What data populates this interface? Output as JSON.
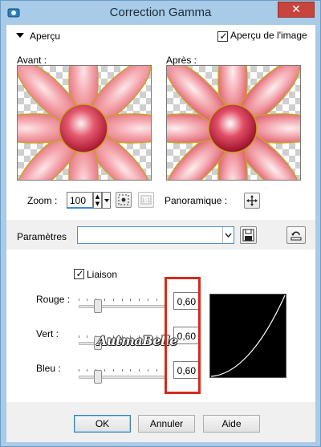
{
  "window": {
    "title": "Correction Gamma",
    "close_glyph": "✕"
  },
  "preview": {
    "section_label": "Aperçu",
    "preview_checkbox_label": "Aperçu de l'image",
    "preview_checked": true,
    "before_label": "Avant :",
    "after_label": "Après :"
  },
  "zoom": {
    "label": "Zoom :",
    "value": "100",
    "pan_label": "Panoramique :"
  },
  "params": {
    "label": "Paramètres",
    "preset_value": ""
  },
  "gamma": {
    "link_label": "Liaison",
    "link_checked": true,
    "channels": [
      {
        "label": "Rouge :",
        "value": "0,60"
      },
      {
        "label": "Vert :",
        "value": "0,60"
      },
      {
        "label": "Bleu :",
        "value": "0,60"
      }
    ],
    "watermark": "AutmaBelle"
  },
  "buttons": {
    "ok": "OK",
    "cancel": "Annuler",
    "help": "Aide"
  },
  "colors": {
    "titlebar": "#a8cbe8",
    "close": "#c7453c",
    "highlight": "#d42a1f",
    "petal": "#ef8f97",
    "petal_light": "#fcd9dd",
    "petal_edge": "#c9a227",
    "center": "#d6324a"
  },
  "icons": {
    "app": "app-icon",
    "close": "close-icon",
    "collapse": "triangle-down-icon",
    "fit": "fit-zoom-icon",
    "actual_size": "actual-size-icon",
    "pan": "move-cross-icon",
    "save_preset": "floppy-disk-icon",
    "reset": "reset-arrow-icon"
  }
}
